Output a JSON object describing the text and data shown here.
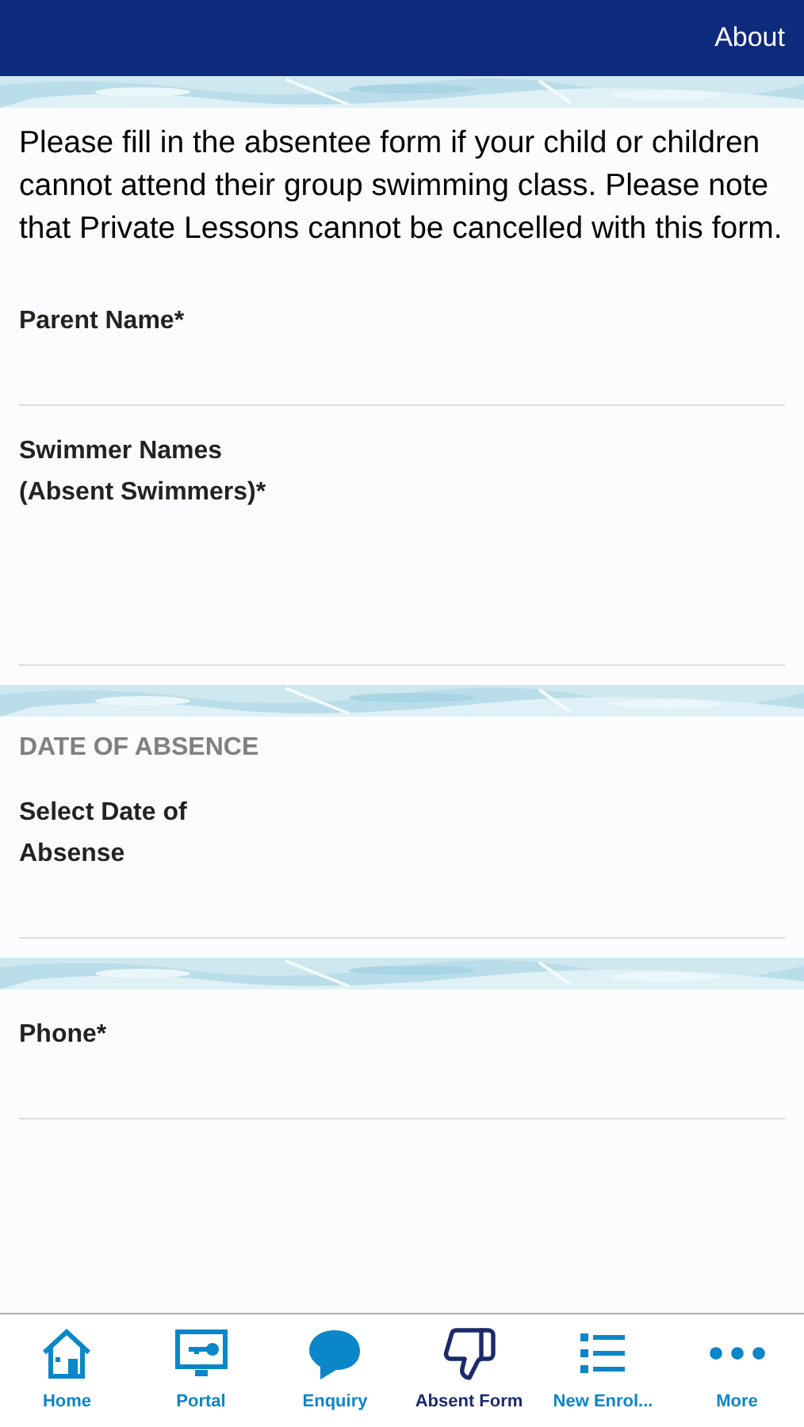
{
  "header": {
    "about_link": "About"
  },
  "intro": "Please fill in the absentee form if your child or children cannot attend their group swimming class. Please note that Private Lessons cannot be cancelled with this form.",
  "sections": [
    {
      "fields": [
        {
          "label": "Parent Name*",
          "kind": "line"
        },
        {
          "label": "Swimmer Names\n(Absent Swimmers)*",
          "kind": "area"
        }
      ]
    },
    {
      "heading": "DATE OF ABSENCE",
      "fields": [
        {
          "label": "Select Date of\nAbsense",
          "kind": "line"
        }
      ]
    },
    {
      "fields": [
        {
          "label": "Phone*",
          "kind": "line"
        }
      ]
    }
  ],
  "tabs": [
    {
      "label": "Home",
      "selected": false
    },
    {
      "label": "Portal",
      "selected": false
    },
    {
      "label": "Enquiry",
      "selected": false
    },
    {
      "label": "Absent Form",
      "selected": true
    },
    {
      "label": "New Enrol...",
      "selected": false
    },
    {
      "label": "More",
      "selected": false
    }
  ]
}
